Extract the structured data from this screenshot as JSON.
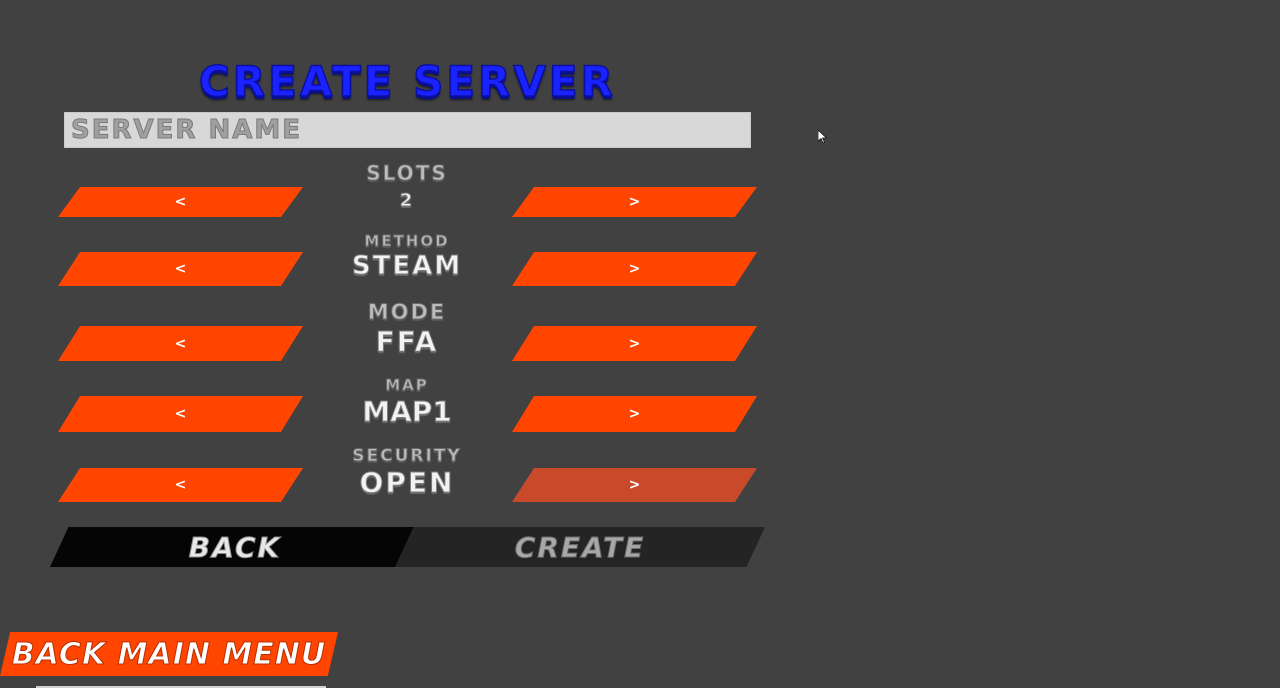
{
  "title": "CREATE SERVER",
  "server_name": {
    "value": "",
    "placeholder": "SERVER NAME"
  },
  "options": [
    {
      "label": "SLOTS",
      "value": "2",
      "prev": "<",
      "next": ">"
    },
    {
      "label": "METHOD",
      "value": "STEAM",
      "prev": "<",
      "next": ">"
    },
    {
      "label": "MODE",
      "value": "FFA",
      "prev": "<",
      "next": ">"
    },
    {
      "label": "MAP",
      "value": "MAP1",
      "prev": "<",
      "next": ">"
    },
    {
      "label": "SECURITY",
      "value": "OPEN",
      "prev": "<",
      "next": ">"
    }
  ],
  "actions": {
    "back": "BACK",
    "create": "CREATE"
  },
  "main_menu": "BACK MAIN MENU",
  "colors": {
    "background": "#414141",
    "accent": "#ff4500",
    "title": "#1a22ff"
  },
  "icons": {
    "cursor": "mouse-pointer-icon"
  }
}
